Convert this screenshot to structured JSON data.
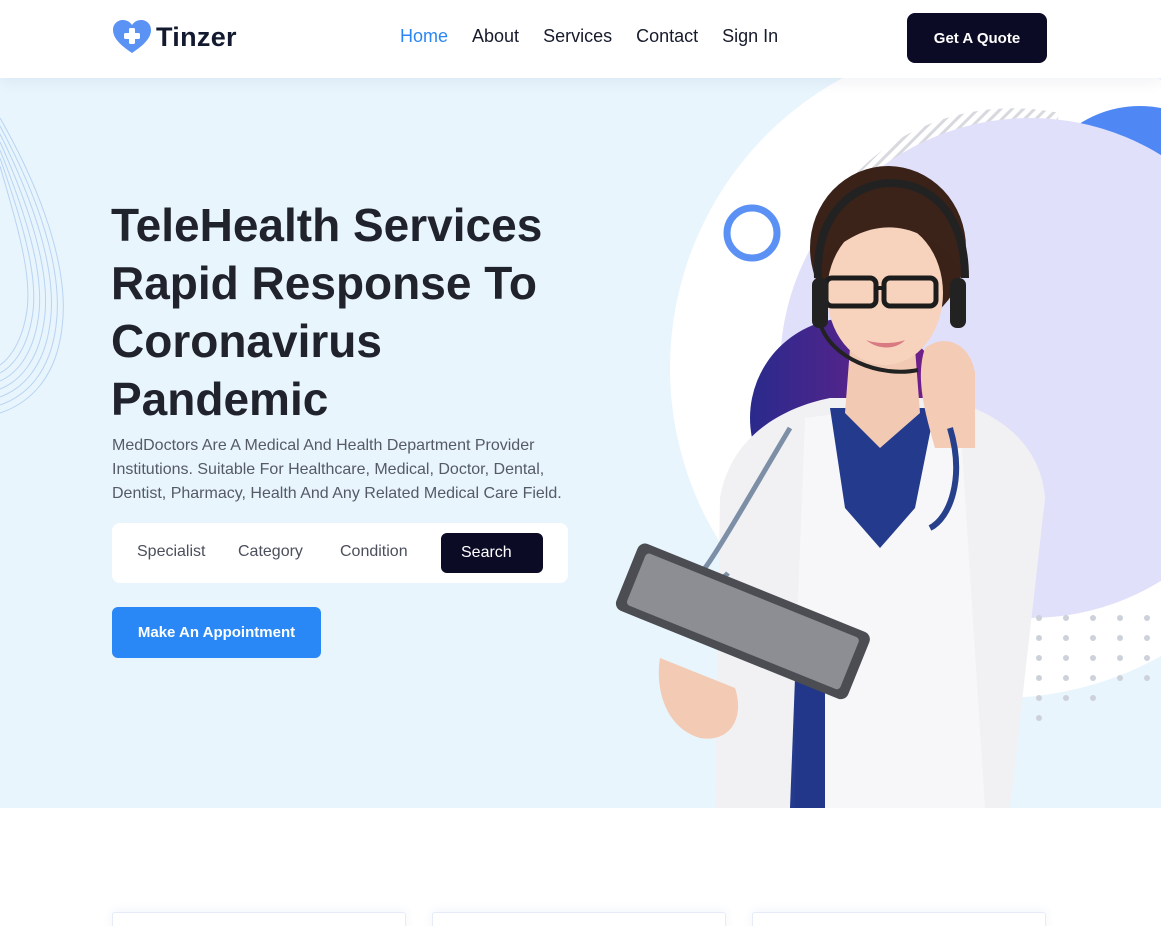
{
  "brand": {
    "name": "Tinzer",
    "accent": "#2b86f5",
    "dark": "#0b0b26",
    "hero_bg": "#e8f5fd"
  },
  "nav": {
    "items": [
      {
        "label": "Home",
        "active": true
      },
      {
        "label": "About",
        "active": false
      },
      {
        "label": "Services",
        "active": false
      },
      {
        "label": "Contact",
        "active": false
      },
      {
        "label": "Sign In",
        "active": false
      }
    ],
    "cta": "Get A Quote"
  },
  "hero": {
    "headline_lines": [
      "TeleHealth Services",
      "Rapid Response To",
      "Coronavirus",
      "Pandemic"
    ],
    "description": "MedDoctors Are A Medical And Health Department Provider Institutions. Suitable For Healthcare, Medical, Doctor, Dental, Dentist, Pharmacy, Health And Any Related Medical Care Field.",
    "search": {
      "selects": [
        "Specialist",
        "Category",
        "Condition"
      ],
      "button": "Search"
    },
    "appointment_button": "Make An Appointment",
    "image_icon": "doctor-with-headset-and-tablet"
  },
  "cards_count_visible": 3
}
